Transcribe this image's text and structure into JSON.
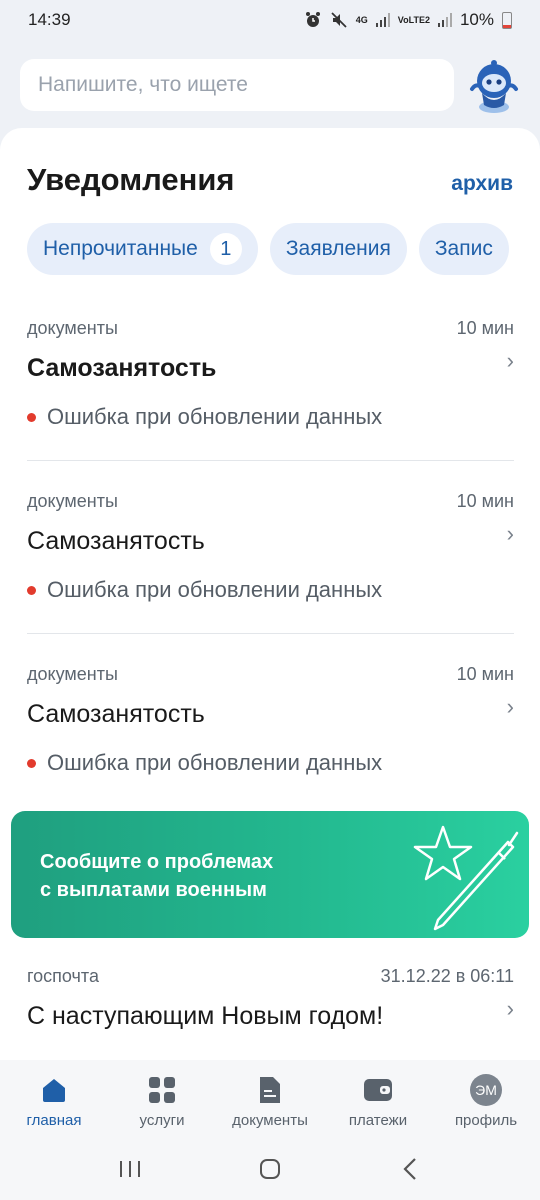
{
  "status_bar": {
    "time": "14:39",
    "battery_percent": "10%",
    "network_1": "4G",
    "network_2": "VoLTE2"
  },
  "search": {
    "placeholder": "Напишите, что ищете"
  },
  "header": {
    "title": "Уведомления",
    "archive_label": "архив"
  },
  "filter_chips": [
    {
      "label": "Непрочитанные",
      "count": "1"
    },
    {
      "label": "Заявления"
    },
    {
      "label": "Запис"
    }
  ],
  "notifications": [
    {
      "category": "документы",
      "time": "10 мин",
      "title": "Самозанятость",
      "status": "Ошибка при обновлении данных",
      "unread": true
    },
    {
      "category": "документы",
      "time": "10 мин",
      "title": "Самозанятость",
      "status": "Ошибка при обновлении данных",
      "unread": false
    },
    {
      "category": "документы",
      "time": "10 мин",
      "title": "Самозанятость",
      "status": "Ошибка при обновлении данных",
      "unread": false
    }
  ],
  "banner": {
    "line1": "Сообщите о проблемах",
    "line2": "с выплатами военным",
    "color_start": "#1f9f7f",
    "color_end": "#2ad0a0"
  },
  "gos_notification": {
    "category": "госпочта",
    "time": "31.12.22 в 06:11",
    "title": "С наступающим Новым годом!"
  },
  "bottom_nav": [
    {
      "label": "главная",
      "icon": "home-icon",
      "active": true
    },
    {
      "label": "услуги",
      "icon": "grid-icon",
      "active": false
    },
    {
      "label": "документы",
      "icon": "document-icon",
      "active": false
    },
    {
      "label": "платежи",
      "icon": "wallet-icon",
      "active": false
    },
    {
      "label": "профиль",
      "icon": "avatar",
      "initials": "ЭМ",
      "active": false
    }
  ],
  "colors": {
    "accent": "#1f5fa8",
    "unread_dot": "#e23b2d",
    "banner": "#23b88f"
  }
}
